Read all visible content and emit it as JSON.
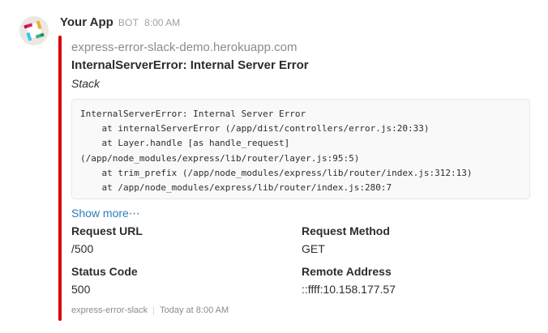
{
  "message": {
    "app_name": "Your App",
    "badge": "BOT",
    "time": "8:00 AM",
    "avatar_icon": "slack-logo-icon"
  },
  "attachment": {
    "color": "#d5000b",
    "pretext": "express-error-slack-demo.herokuapp.com",
    "title": "InternalServerError: Internal Server Error",
    "subtitle": "Stack",
    "stack_lines": [
      "InternalServerError: Internal Server Error",
      "    at internalServerError (/app/dist/controllers/error.js:20:33)",
      "    at Layer.handle [as handle_request]",
      "(/app/node_modules/express/lib/router/layer.js:95:5)",
      "    at trim_prefix (/app/node_modules/express/lib/router/index.js:312:13)",
      "    at /app/node_modules/express/lib/router/index.js:280:7"
    ],
    "show_more": "Show more⋯",
    "fields": [
      {
        "title": "Request URL",
        "value": "/500"
      },
      {
        "title": "Request Method",
        "value": "GET"
      },
      {
        "title": "Status Code",
        "value": "500"
      },
      {
        "title": "Remote Address",
        "value": "::ffff:10.158.177.57"
      }
    ],
    "footer": "express-error-slack",
    "footer_time": "Today at 8:00 AM"
  }
}
